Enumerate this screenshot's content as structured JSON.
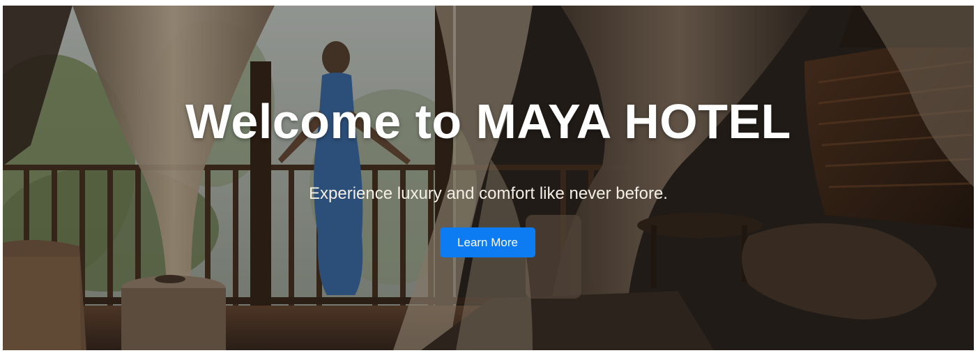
{
  "hero": {
    "title": "Welcome to MAYA HOTEL",
    "subtitle": "Experience luxury and comfort like never before.",
    "button_label": "Learn More",
    "background_image": "hotel-bedroom-balcony-photo"
  },
  "colors": {
    "button": "#0d7cf2",
    "title_text": "#ffffff",
    "subtitle_text": "#f4efe6"
  }
}
